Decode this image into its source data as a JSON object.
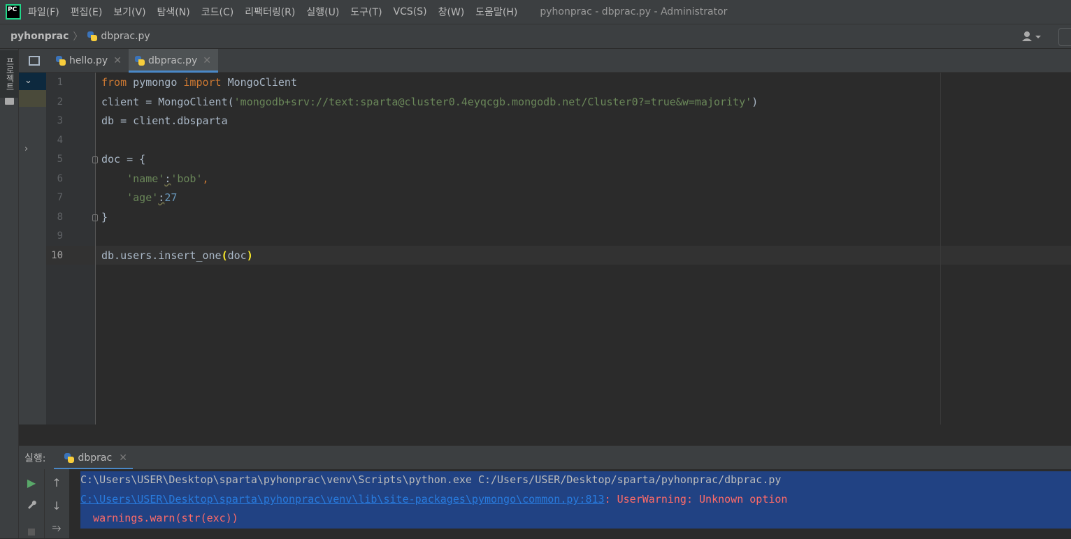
{
  "menubar": {
    "items": [
      "파일(F)",
      "편집(E)",
      "보기(V)",
      "탐색(N)",
      "코드(C)",
      "리팩터링(R)",
      "실행(U)",
      "도구(T)",
      "VCS(S)",
      "창(W)",
      "도움말(H)"
    ],
    "window_title": "pyhonprac - dbprac.py - Administrator",
    "logo_text": "PC"
  },
  "navbar": {
    "project": "pyhonprac",
    "separator": "〉",
    "file": "dbprac.py"
  },
  "left_strip": {
    "project_tab_label": "프로젝트"
  },
  "tabs": [
    {
      "label": "hello.py",
      "active": false
    },
    {
      "label": "dbprac.py",
      "active": true
    }
  ],
  "editor": {
    "line_numbers": [
      "1",
      "2",
      "3",
      "4",
      "5",
      "6",
      "7",
      "8",
      "9",
      "10"
    ],
    "current_line": "10",
    "code": {
      "l1_kw1": "from",
      "l1_mod": " pymongo ",
      "l1_kw2": "import",
      "l1_rest": " MongoClient",
      "l2_pre": "client = MongoClient(",
      "l2_str": "'mongodb+srv://text:sparta@cluster0.4eyqcgb.mongodb.net/Cluster0?=true&w=majority'",
      "l2_post": ")",
      "l3": "db = client.dbsparta",
      "l5": "doc = {",
      "l6_key": "'name'",
      "l6_colon": ":",
      "l6_val": "'bob'",
      "l6_comma": ",",
      "l7_key": "'age'",
      "l7_colon": ":",
      "l7_val": "27",
      "l8": "}",
      "l10_pre": "db.users.insert_one",
      "l10_open": "(",
      "l10_arg": "doc",
      "l10_close": ")"
    }
  },
  "run_panel": {
    "label": "실행:",
    "tab_label": "dbprac",
    "console": {
      "line1": "C:\\Users\\USER\\Desktop\\sparta\\pyhonprac\\venv\\Scripts\\python.exe C:/Users/USER/Desktop/sparta/pyhonprac/dbprac.py",
      "line2_link": "C:\\Users\\USER\\Desktop\\sparta\\pyhonprac\\venv\\lib\\site-packages\\pymongo\\common.py:813",
      "line2_msg": ": UserWarning: Unknown option",
      "line3": "  warnings.warn(str(exc))"
    }
  },
  "colors": {
    "keyword": "#cc7832",
    "string": "#6a8759",
    "number": "#6897bb",
    "error": "#ff6b68",
    "link": "#287bde",
    "selection": "#214283",
    "accent": "#4a88c7"
  }
}
